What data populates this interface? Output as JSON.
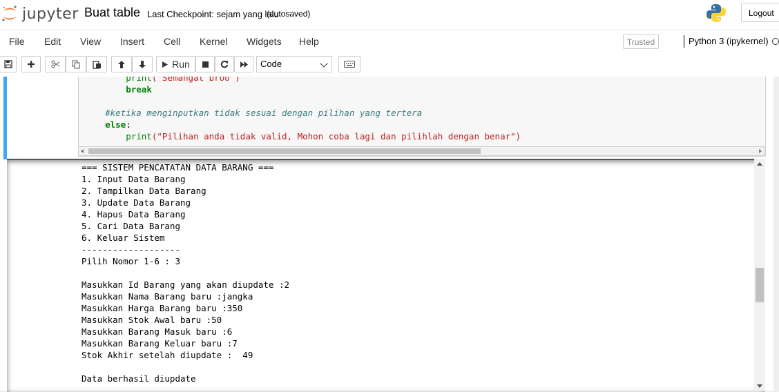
{
  "header": {
    "logo_text": "jupyter",
    "notebook_name": "Buat table",
    "checkpoint": "Last Checkpoint: sejam yang lalu",
    "autosaved": "(autosaved)",
    "logout_label": "Logout"
  },
  "menubar": {
    "items": [
      "File",
      "Edit",
      "View",
      "Insert",
      "Cell",
      "Kernel",
      "Widgets",
      "Help"
    ],
    "trusted_label": "Trusted",
    "kernel_label": "Python 3 (ipykernel)"
  },
  "toolbar": {
    "run_label": "Run",
    "cell_type": "Code",
    "icons": [
      "save-icon",
      "plus-icon",
      "cut-icon",
      "copy-icon",
      "paste-icon",
      "arrow-up-icon",
      "arrow-down-icon",
      "run-icon",
      "stop-icon",
      "restart-icon",
      "fast-forward-icon",
      "keyboard-icon"
    ]
  },
  "code_cell": {
    "lines": [
      {
        "indent": "        ",
        "builtin": "print",
        "string": "(\"Semangat broo\")"
      },
      {
        "indent": "        ",
        "keyword": "break"
      },
      {
        "blank": true
      },
      {
        "indent": "    ",
        "comment": "#ketika menginputkan tidak sesuai dengan pilihan yang tertera"
      },
      {
        "indent": "    ",
        "keyword": "else",
        "rest": ":"
      },
      {
        "indent": "        ",
        "builtin": "print",
        "string": "(\"Pilihan anda tidak valid, Mohon coba lagi dan pilihlah dengan benar\")"
      }
    ]
  },
  "output": {
    "lines": [
      "=== SISTEM PENCATATAN DATA BARANG ===",
      "1. Input Data Barang",
      "2. Tampilkan Data Barang",
      "3. Update Data Barang",
      "4. Hapus Data Barang",
      "5. Cari Data Barang",
      "6. Keluar Sistem",
      "-------------------",
      "Pilih Nomor 1-6 : 3",
      "",
      "Masukkan Id Barang yang akan diupdate :2",
      "Masukkan Nama Barang baru :jangka",
      "Masukkan Harga Barang baru :350",
      "Masukkan Stok Awal baru :50",
      "Masukkan Barang Masuk baru :6",
      "Masukkan Barang Keluar baru :7",
      "Stok Akhir setelah diupdate :  49",
      "",
      "Data berhasil diupdate"
    ]
  },
  "colors": {
    "selected_cell_bar": "#42a5f5",
    "keyword": "#008000",
    "string": "#ba2121",
    "comment": "#408080",
    "logo_orange": "#f37626"
  }
}
